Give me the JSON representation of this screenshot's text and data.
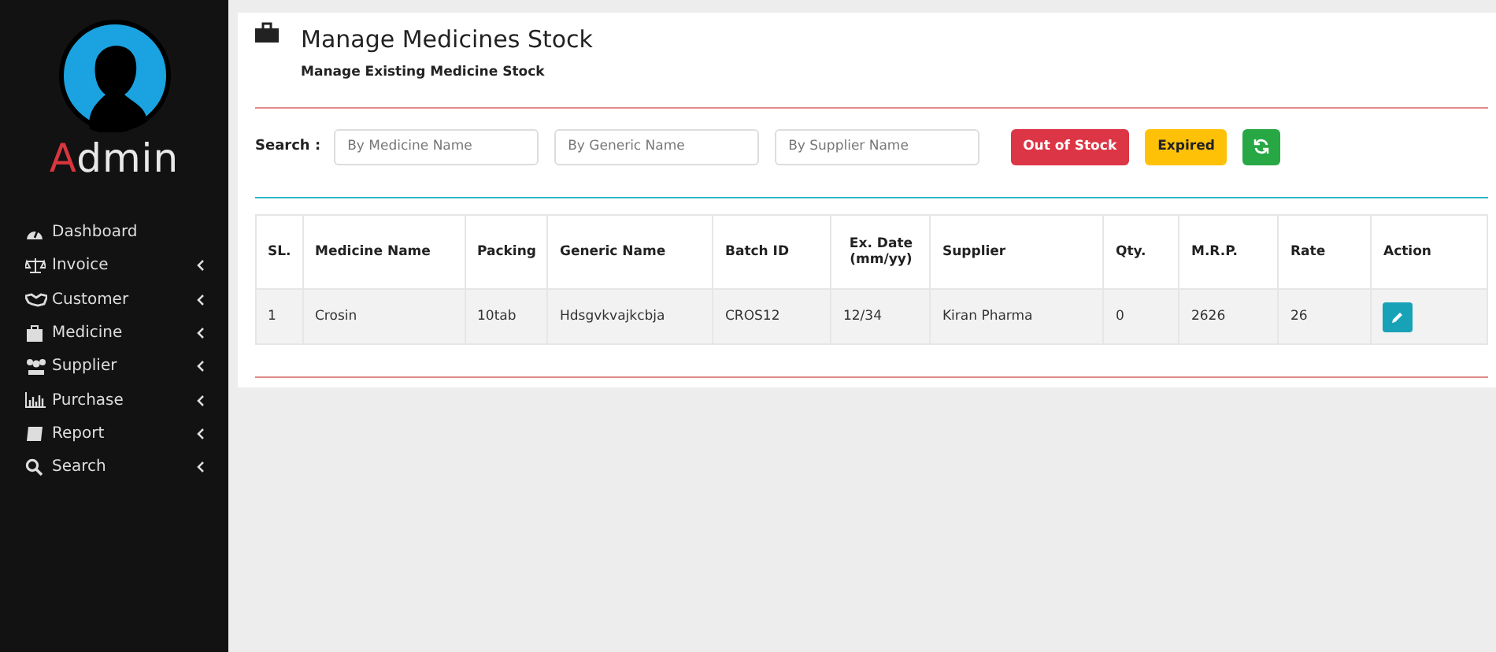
{
  "sidebar": {
    "user": "Admin",
    "items": [
      {
        "label": "Dashboard",
        "has_submenu": false
      },
      {
        "label": "Invoice",
        "has_submenu": true
      },
      {
        "label": "Customer",
        "has_submenu": true
      },
      {
        "label": "Medicine",
        "has_submenu": true
      },
      {
        "label": "Supplier",
        "has_submenu": true
      },
      {
        "label": "Purchase",
        "has_submenu": true
      },
      {
        "label": "Report",
        "has_submenu": true
      },
      {
        "label": "Search",
        "has_submenu": true
      }
    ]
  },
  "header": {
    "title": "Manage Medicines Stock",
    "subtitle": "Manage Existing Medicine Stock"
  },
  "search": {
    "label": "Search :",
    "fields": [
      {
        "placeholder": "By Medicine Name"
      },
      {
        "placeholder": "By Generic Name"
      },
      {
        "placeholder": "By Supplier Name"
      }
    ],
    "buttons": [
      {
        "label": "Out of Stock",
        "kind": "danger"
      },
      {
        "label": "Expired",
        "kind": "warning"
      },
      {
        "kind": "refresh"
      }
    ]
  },
  "table": {
    "columns": [
      "SL.",
      "Medicine Name",
      "Packing",
      "Generic Name",
      "Batch ID",
      "Ex. Date (mm/yy)",
      "Supplier",
      "Qty.",
      "M.R.P.",
      "Rate",
      "Action"
    ],
    "rows": [
      {
        "cells": [
          "1",
          "Crosin",
          "10tab",
          "Hdsgvkvajkcbja",
          "CROS12",
          "12/34",
          "Kiran Pharma",
          "0",
          "2626",
          "26"
        ]
      }
    ]
  }
}
